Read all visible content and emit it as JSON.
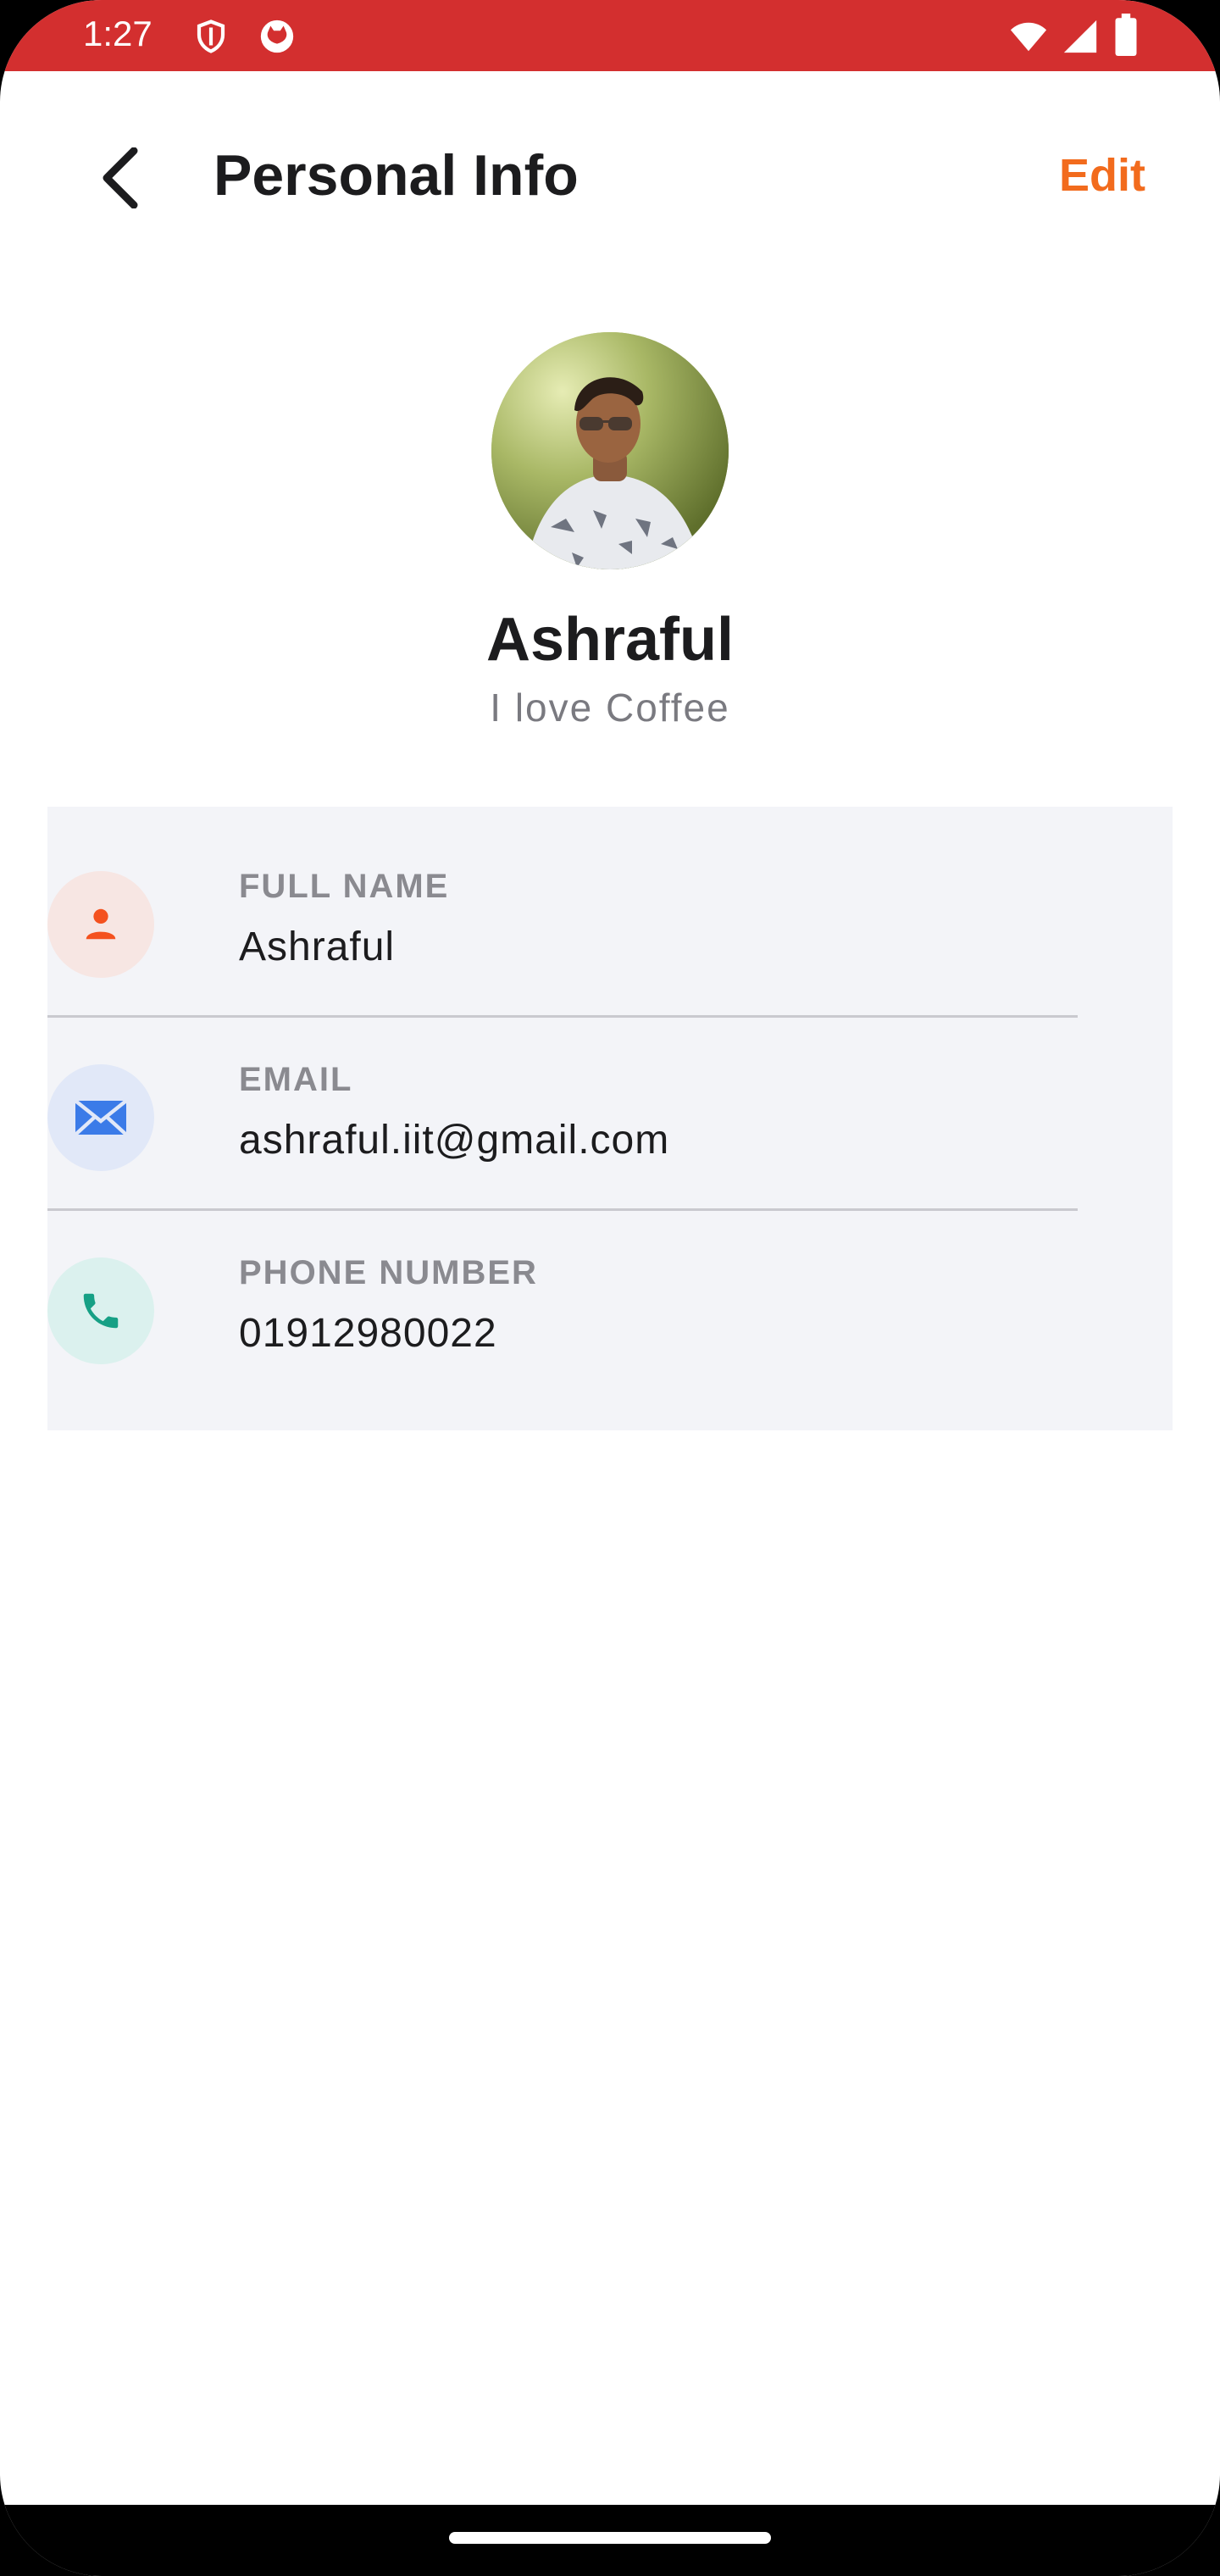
{
  "status_bar": {
    "time": "1:27",
    "background": "#d32f2f",
    "icons": [
      "shield-icon",
      "cat-icon",
      "wifi-icon",
      "signal-icon",
      "battery-icon"
    ]
  },
  "header": {
    "title": "Personal Info",
    "edit_label": "Edit",
    "back_icon": "back-arrow-icon"
  },
  "profile": {
    "name": "Ashraful",
    "bio": "I love Coffee"
  },
  "info": {
    "items": [
      {
        "label": "FULL NAME",
        "value": "Ashraful",
        "icon": "person-icon",
        "icon_color": "#f4511e",
        "icon_bg": "#f7e6e3"
      },
      {
        "label": "EMAIL",
        "value": "ashraful.iit@gmail.com",
        "icon": "mail-icon",
        "icon_color": "#3b7be8",
        "icon_bg": "#e1e8f8"
      },
      {
        "label": "PHONE NUMBER",
        "value": "01912980022",
        "icon": "phone-icon",
        "icon_color": "#16a085",
        "icon_bg": "#dbf1ee"
      }
    ]
  },
  "colors": {
    "accent": "#f26b1d",
    "card_bg": "#f3f4f8"
  }
}
